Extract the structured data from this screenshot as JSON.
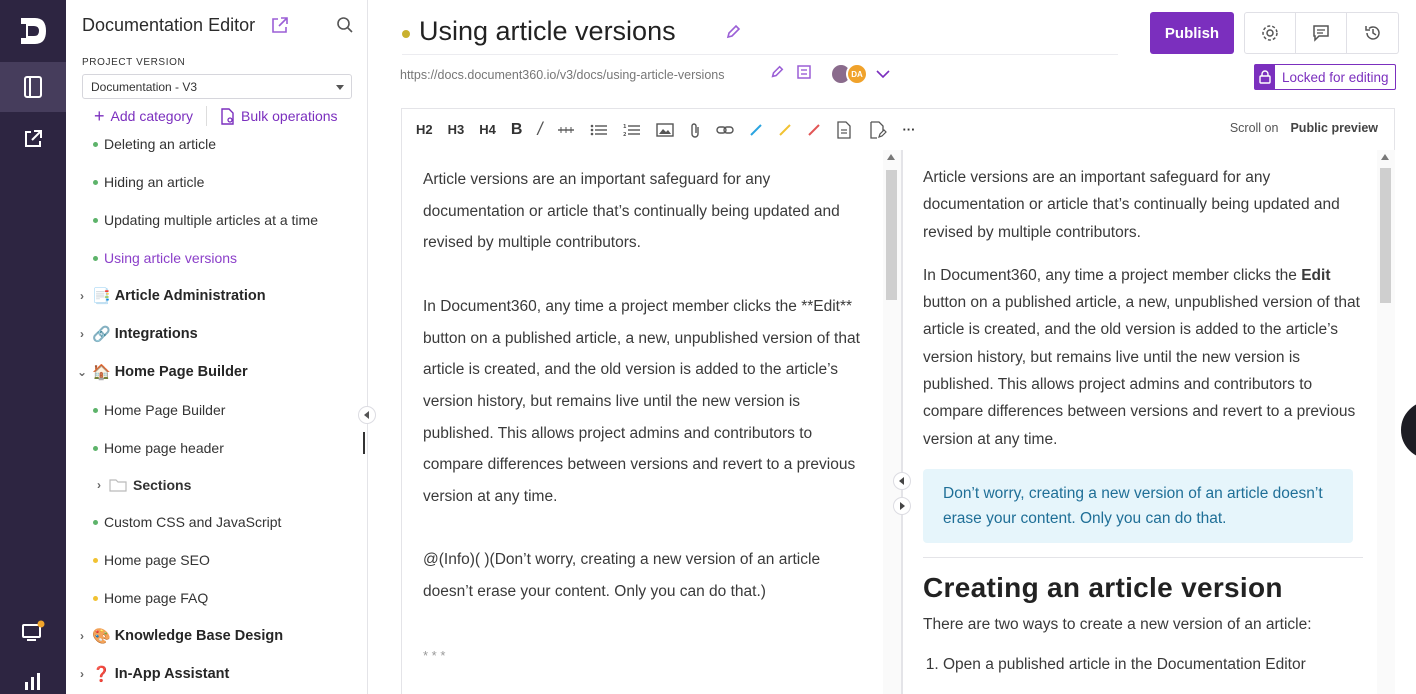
{
  "sidebar": {
    "title": "Documentation Editor",
    "project_version_label": "PROJECT VERSION",
    "project_version_value": "Documentation - V3",
    "add_category": "Add category",
    "bulk_operations": "Bulk operations",
    "items": [
      {
        "label": "Deleting an article",
        "kind": "article",
        "status": "published"
      },
      {
        "label": "Hiding an article",
        "kind": "article",
        "status": "published"
      },
      {
        "label": "Updating multiple articles at a time",
        "kind": "article",
        "status": "published"
      },
      {
        "label": "Using article versions",
        "kind": "article",
        "status": "published",
        "active": true
      },
      {
        "label": "Article Administration",
        "kind": "category",
        "icon": "📑"
      },
      {
        "label": "Integrations",
        "kind": "category",
        "icon": "🔗"
      },
      {
        "label": "Home Page Builder",
        "kind": "category",
        "icon": "🏠",
        "expanded": true
      },
      {
        "label": "Home Page Builder",
        "kind": "article",
        "status": "published"
      },
      {
        "label": "Home page header",
        "kind": "article",
        "status": "published"
      },
      {
        "label": "Sections",
        "kind": "folder"
      },
      {
        "label": "Custom CSS and JavaScript",
        "kind": "article",
        "status": "published"
      },
      {
        "label": "Home page SEO",
        "kind": "article",
        "status": "draft"
      },
      {
        "label": "Home page FAQ",
        "kind": "article",
        "status": "draft"
      },
      {
        "label": "Knowledge Base Design",
        "kind": "category",
        "icon": "🎨"
      },
      {
        "label": "In-App Assistant",
        "kind": "category",
        "icon": "❓"
      }
    ]
  },
  "header": {
    "title": "Using article versions",
    "url": "https://docs.document360.io/v3/docs/using-article-versions",
    "avatar_initials": "DA",
    "publish_label": "Publish",
    "locked_label": "Locked for editing"
  },
  "toolbar": {
    "h2": "H2",
    "h3": "H3",
    "h4": "H4",
    "bold": "B",
    "italic": "/",
    "more": "···",
    "scroll_on": "Scroll on",
    "public_preview": "Public preview"
  },
  "editor": {
    "p1": "Article versions are an important safeguard for any documentation or article that’s continually being updated and revised by multiple contributors.",
    "p2": "In Document360, any time a project member clicks the **Edit** button on a published article, a new, unpublished version of that article is created, and the old version is added to the article’s version history, but remains live until the new version is published. This allows project admins and contributors to compare differences between versions and revert to a previous version at any time.",
    "p3": "@(Info)( )(Don’t worry, creating a new version of an article doesn’t erase your content. Only you can do that.)",
    "p4": "* * *"
  },
  "preview": {
    "p1": "Article versions are an important safeguard for any documentation or article that’s continually being updated and revised by multiple contributors.",
    "p2_before": "In Document360, any time a project member clicks the ",
    "p2_bold": "Edit",
    "p2_after": " button on a published article, a new, unpublished version of that article is created, and the old version is added to the article’s version history, but remains live until the new version is published. This allows project admins and contributors to compare differences between versions and revert to a previous version at any time.",
    "info": "Don’t worry, creating a new version of an article doesn’t erase your content. Only you can do that.",
    "h2": "Creating an article version",
    "p3": "There are two ways to create a new version of an article:",
    "li1": "Open a published article in the Documentation Editor"
  },
  "colors": {
    "brand": "#7b2fbe",
    "rail": "#2d2541",
    "published_dot": "#5db36a",
    "draft_dot": "#f1c232",
    "info_bg": "#e6f5fb"
  }
}
